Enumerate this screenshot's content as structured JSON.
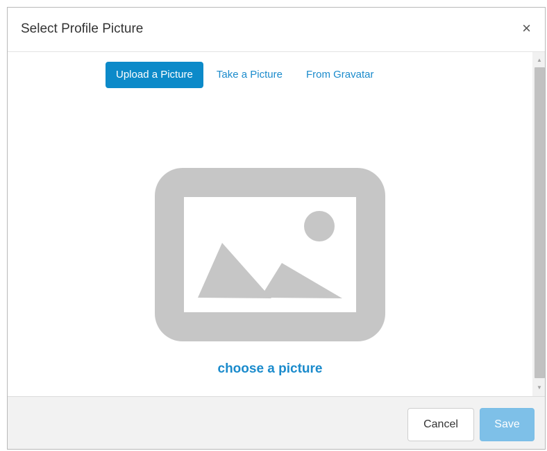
{
  "dialog": {
    "title": "Select Profile Picture",
    "close_symbol": "×"
  },
  "tabs": [
    {
      "label": "Upload a Picture",
      "active": true
    },
    {
      "label": "Take a Picture",
      "active": false
    },
    {
      "label": "From Gravatar",
      "active": false
    }
  ],
  "upload": {
    "placeholder_icon": "image-placeholder-icon",
    "choose_label": "choose a picture"
  },
  "footer": {
    "cancel_label": "Cancel",
    "save_label": "Save"
  },
  "colors": {
    "accent": "#0c8ac9",
    "link": "#1b8bcc",
    "save_disabled": "#7ec0e8",
    "placeholder_gray": "#c6c6c6"
  }
}
